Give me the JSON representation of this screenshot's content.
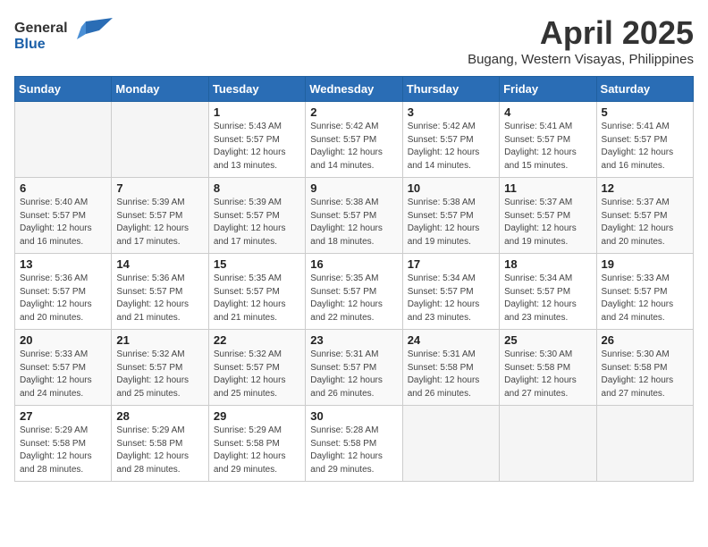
{
  "header": {
    "logo_general": "General",
    "logo_blue": "Blue",
    "month_title": "April 2025",
    "subtitle": "Bugang, Western Visayas, Philippines"
  },
  "weekdays": [
    "Sunday",
    "Monday",
    "Tuesday",
    "Wednesday",
    "Thursday",
    "Friday",
    "Saturday"
  ],
  "weeks": [
    [
      {
        "day": "",
        "info": ""
      },
      {
        "day": "",
        "info": ""
      },
      {
        "day": "1",
        "sunrise": "Sunrise: 5:43 AM",
        "sunset": "Sunset: 5:57 PM",
        "daylight": "Daylight: 12 hours and 13 minutes."
      },
      {
        "day": "2",
        "sunrise": "Sunrise: 5:42 AM",
        "sunset": "Sunset: 5:57 PM",
        "daylight": "Daylight: 12 hours and 14 minutes."
      },
      {
        "day": "3",
        "sunrise": "Sunrise: 5:42 AM",
        "sunset": "Sunset: 5:57 PM",
        "daylight": "Daylight: 12 hours and 14 minutes."
      },
      {
        "day": "4",
        "sunrise": "Sunrise: 5:41 AM",
        "sunset": "Sunset: 5:57 PM",
        "daylight": "Daylight: 12 hours and 15 minutes."
      },
      {
        "day": "5",
        "sunrise": "Sunrise: 5:41 AM",
        "sunset": "Sunset: 5:57 PM",
        "daylight": "Daylight: 12 hours and 16 minutes."
      }
    ],
    [
      {
        "day": "6",
        "sunrise": "Sunrise: 5:40 AM",
        "sunset": "Sunset: 5:57 PM",
        "daylight": "Daylight: 12 hours and 16 minutes."
      },
      {
        "day": "7",
        "sunrise": "Sunrise: 5:39 AM",
        "sunset": "Sunset: 5:57 PM",
        "daylight": "Daylight: 12 hours and 17 minutes."
      },
      {
        "day": "8",
        "sunrise": "Sunrise: 5:39 AM",
        "sunset": "Sunset: 5:57 PM",
        "daylight": "Daylight: 12 hours and 17 minutes."
      },
      {
        "day": "9",
        "sunrise": "Sunrise: 5:38 AM",
        "sunset": "Sunset: 5:57 PM",
        "daylight": "Daylight: 12 hours and 18 minutes."
      },
      {
        "day": "10",
        "sunrise": "Sunrise: 5:38 AM",
        "sunset": "Sunset: 5:57 PM",
        "daylight": "Daylight: 12 hours and 19 minutes."
      },
      {
        "day": "11",
        "sunrise": "Sunrise: 5:37 AM",
        "sunset": "Sunset: 5:57 PM",
        "daylight": "Daylight: 12 hours and 19 minutes."
      },
      {
        "day": "12",
        "sunrise": "Sunrise: 5:37 AM",
        "sunset": "Sunset: 5:57 PM",
        "daylight": "Daylight: 12 hours and 20 minutes."
      }
    ],
    [
      {
        "day": "13",
        "sunrise": "Sunrise: 5:36 AM",
        "sunset": "Sunset: 5:57 PM",
        "daylight": "Daylight: 12 hours and 20 minutes."
      },
      {
        "day": "14",
        "sunrise": "Sunrise: 5:36 AM",
        "sunset": "Sunset: 5:57 PM",
        "daylight": "Daylight: 12 hours and 21 minutes."
      },
      {
        "day": "15",
        "sunrise": "Sunrise: 5:35 AM",
        "sunset": "Sunset: 5:57 PM",
        "daylight": "Daylight: 12 hours and 21 minutes."
      },
      {
        "day": "16",
        "sunrise": "Sunrise: 5:35 AM",
        "sunset": "Sunset: 5:57 PM",
        "daylight": "Daylight: 12 hours and 22 minutes."
      },
      {
        "day": "17",
        "sunrise": "Sunrise: 5:34 AM",
        "sunset": "Sunset: 5:57 PM",
        "daylight": "Daylight: 12 hours and 23 minutes."
      },
      {
        "day": "18",
        "sunrise": "Sunrise: 5:34 AM",
        "sunset": "Sunset: 5:57 PM",
        "daylight": "Daylight: 12 hours and 23 minutes."
      },
      {
        "day": "19",
        "sunrise": "Sunrise: 5:33 AM",
        "sunset": "Sunset: 5:57 PM",
        "daylight": "Daylight: 12 hours and 24 minutes."
      }
    ],
    [
      {
        "day": "20",
        "sunrise": "Sunrise: 5:33 AM",
        "sunset": "Sunset: 5:57 PM",
        "daylight": "Daylight: 12 hours and 24 minutes."
      },
      {
        "day": "21",
        "sunrise": "Sunrise: 5:32 AM",
        "sunset": "Sunset: 5:57 PM",
        "daylight": "Daylight: 12 hours and 25 minutes."
      },
      {
        "day": "22",
        "sunrise": "Sunrise: 5:32 AM",
        "sunset": "Sunset: 5:57 PM",
        "daylight": "Daylight: 12 hours and 25 minutes."
      },
      {
        "day": "23",
        "sunrise": "Sunrise: 5:31 AM",
        "sunset": "Sunset: 5:57 PM",
        "daylight": "Daylight: 12 hours and 26 minutes."
      },
      {
        "day": "24",
        "sunrise": "Sunrise: 5:31 AM",
        "sunset": "Sunset: 5:58 PM",
        "daylight": "Daylight: 12 hours and 26 minutes."
      },
      {
        "day": "25",
        "sunrise": "Sunrise: 5:30 AM",
        "sunset": "Sunset: 5:58 PM",
        "daylight": "Daylight: 12 hours and 27 minutes."
      },
      {
        "day": "26",
        "sunrise": "Sunrise: 5:30 AM",
        "sunset": "Sunset: 5:58 PM",
        "daylight": "Daylight: 12 hours and 27 minutes."
      }
    ],
    [
      {
        "day": "27",
        "sunrise": "Sunrise: 5:29 AM",
        "sunset": "Sunset: 5:58 PM",
        "daylight": "Daylight: 12 hours and 28 minutes."
      },
      {
        "day": "28",
        "sunrise": "Sunrise: 5:29 AM",
        "sunset": "Sunset: 5:58 PM",
        "daylight": "Daylight: 12 hours and 28 minutes."
      },
      {
        "day": "29",
        "sunrise": "Sunrise: 5:29 AM",
        "sunset": "Sunset: 5:58 PM",
        "daylight": "Daylight: 12 hours and 29 minutes."
      },
      {
        "day": "30",
        "sunrise": "Sunrise: 5:28 AM",
        "sunset": "Sunset: 5:58 PM",
        "daylight": "Daylight: 12 hours and 29 minutes."
      },
      {
        "day": "",
        "info": ""
      },
      {
        "day": "",
        "info": ""
      },
      {
        "day": "",
        "info": ""
      }
    ]
  ]
}
